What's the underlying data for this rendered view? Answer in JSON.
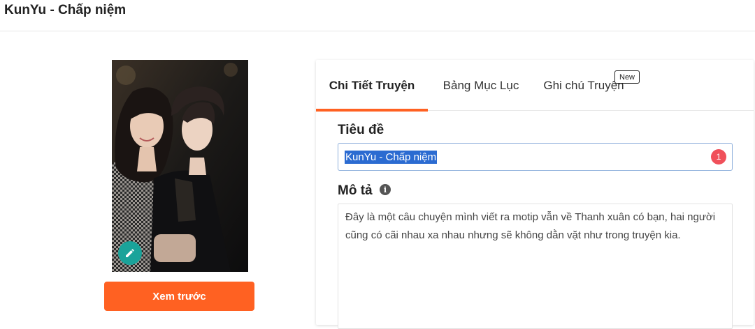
{
  "header": {
    "title": "KunYu - Chấp niệm"
  },
  "cover": {
    "edit_icon": "pencil-icon"
  },
  "preview_button": {
    "label": "Xem trước"
  },
  "tabs": [
    {
      "label": "Chi Tiết Truyện",
      "active": true
    },
    {
      "label": "Bảng Mục Lục",
      "active": false
    },
    {
      "label": "Ghi chú Truyện",
      "active": false,
      "badge": "New"
    }
  ],
  "form": {
    "title_label": "Tiêu đề",
    "title_value": "KunYu - Chấp niệm",
    "title_error_count": "1",
    "description_label": "Mô tả",
    "description_info_icon": "info-icon",
    "description_value": "Đây là một câu chuyện mình viết ra motip vẫn về Thanh xuân có bạn, hai người cũng có cãi nhau xa nhau nhưng sẽ không dằn vặt như trong truyện kia."
  },
  "colors": {
    "accent": "#ff6122",
    "teal": "#1aa39a",
    "error": "#f0505a",
    "selection": "#2b6bd1"
  }
}
